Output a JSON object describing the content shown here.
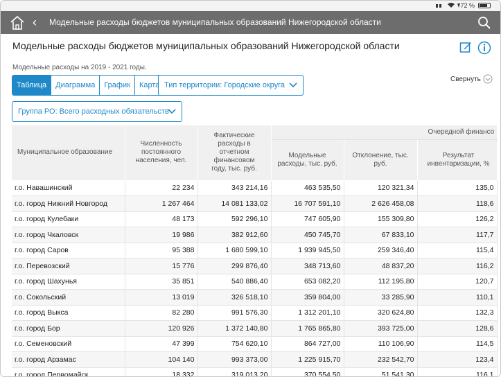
{
  "status": {
    "battery": "72 %"
  },
  "nav": {
    "title": "Модельные расходы бюджетов муниципальных образований Нижегородской области",
    "back": "‹"
  },
  "page": {
    "title": "Модельные расходы бюджетов муниципальных образований Нижегородской области",
    "subtitle": "Модельные расходы на 2019 - 2021 годы.",
    "collapse_label": "Свернуть"
  },
  "tabs": [
    {
      "label": "Таблица",
      "active": true
    },
    {
      "label": "Диаграмма",
      "active": false
    },
    {
      "label": "График",
      "active": false
    },
    {
      "label": "Карта",
      "active": false
    }
  ],
  "filters": {
    "territory": "Тип территории: Городские округа",
    "group": "Группа РО: Всего расходных обязательств"
  },
  "table": {
    "headers": {
      "municipality": "Муниципальное образование",
      "population": "Численность постоянного населения, чел.",
      "actual": "Фактические расходы в отчетном финансовом году, тыс. руб.",
      "group": "Очередной финансо",
      "model": "Модельные расходы, тыс. руб.",
      "deviation": "Отклонение, тыс. руб.",
      "result": "Результат инвентаризации, %"
    },
    "rows": [
      [
        "г.о. Навашинский",
        "22 234",
        "343 214,16",
        "463 535,50",
        "120 321,34",
        "135,0"
      ],
      [
        "г.о. город Нижний Новгород",
        "1 267 464",
        "14 081 133,02",
        "16 707 591,10",
        "2 626 458,08",
        "118,6"
      ],
      [
        "г.о. город Кулебаки",
        "48 173",
        "592 296,10",
        "747 605,90",
        "155 309,80",
        "126,2"
      ],
      [
        "г.о. город Чкаловск",
        "19 986",
        "382 912,60",
        "450 745,70",
        "67 833,10",
        "117,7"
      ],
      [
        "г.о. город Саров",
        "95 388",
        "1 680 599,10",
        "1 939 945,50",
        "259 346,40",
        "115,4"
      ],
      [
        "г.о. Перевозский",
        "15 776",
        "299 876,40",
        "348 713,60",
        "48 837,20",
        "116,2"
      ],
      [
        "г.о. город Шахунья",
        "35 851",
        "540 886,40",
        "653 082,20",
        "112 195,80",
        "120,7"
      ],
      [
        "г.о. Сокольский",
        "13 019",
        "326 518,10",
        "359 804,00",
        "33 285,90",
        "110,1"
      ],
      [
        "г.о. город Выкса",
        "82 280",
        "991 576,30",
        "1 312 201,10",
        "320 624,80",
        "132,3"
      ],
      [
        "г.о. город Бор",
        "120 926",
        "1 372 140,80",
        "1 765 865,80",
        "393 725,00",
        "128,6"
      ],
      [
        "г.о. Семеновский",
        "47 399",
        "754 620,10",
        "864 727,00",
        "110 106,90",
        "114,5"
      ],
      [
        "г.о. город Арзамас",
        "104 140",
        "993 373,00",
        "1 225 915,70",
        "232 542,70",
        "123,4"
      ],
      [
        "г.о. город Первомайск",
        "18 332",
        "319 013,20",
        "370 554,50",
        "51 541,30",
        "116,1"
      ]
    ]
  },
  "colors": {
    "accent": "#1e88c8",
    "navbar": "#6d6d6d"
  },
  "icons": [
    "home-icon",
    "back-icon",
    "search-icon",
    "edit-icon",
    "info-icon",
    "chevron-down-icon",
    "wifi-icon",
    "battery-icon"
  ]
}
